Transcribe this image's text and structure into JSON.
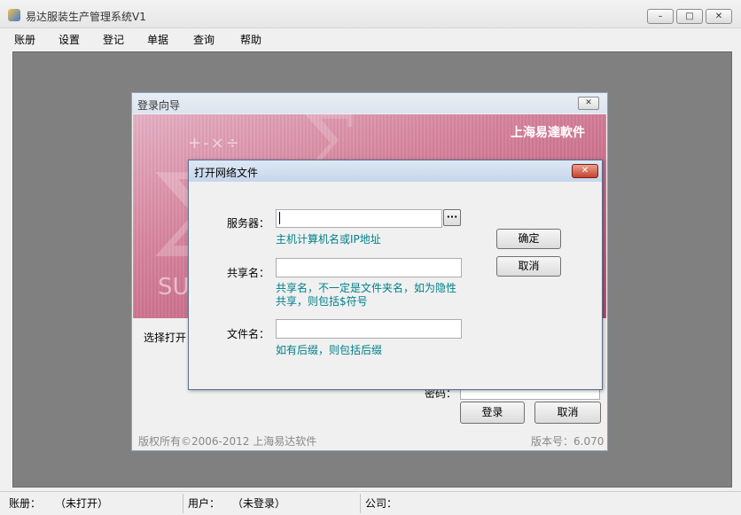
{
  "app": {
    "title": "易达服装生产管理系统V1",
    "minimize_glyph": "–",
    "maximize_glyph": "□",
    "close_glyph": "✕"
  },
  "menu": [
    "账册",
    "设置",
    "登记",
    "单据",
    "查询",
    "帮助"
  ],
  "status_bar": {
    "book_label": "账册：",
    "book_value": "（未打开）",
    "user_label": "用户：",
    "user_value": "（未登录）",
    "company_label": "公司："
  },
  "login_dialog": {
    "title": "登录向导",
    "close_glyph": "✕",
    "banner_company": "上海易達軟件",
    "banner_ops": "+-×÷",
    "banner_partial_text": "SU",
    "select_label_partial": "选择打开",
    "password_label": "密码：",
    "login_button": "登录",
    "cancel_button": "取消",
    "copyright": "版权所有©2006-2012 上海易达软件",
    "version": "版本号：6.070"
  },
  "network_dialog": {
    "title": "打开网络文件",
    "close_glyph": "✕",
    "server_label": "服务器：",
    "server_value": "",
    "browse_glyph": "···",
    "server_hint": "主机计算机名或IP地址",
    "share_label": "共享名：",
    "share_value": "",
    "share_hint_line1": "共享名，不一定是文件夹名，如为隐性",
    "share_hint_line2": "共享，则包括$符号",
    "file_label": "文件名：",
    "file_value": "",
    "file_hint": "如有后缀，则包括后缀",
    "ok_button": "确定",
    "cancel_button": "取消"
  },
  "colors": {
    "hint_text": "#00808a",
    "mdi_background": "#808080",
    "banner_pink": "#cc6f8d"
  }
}
